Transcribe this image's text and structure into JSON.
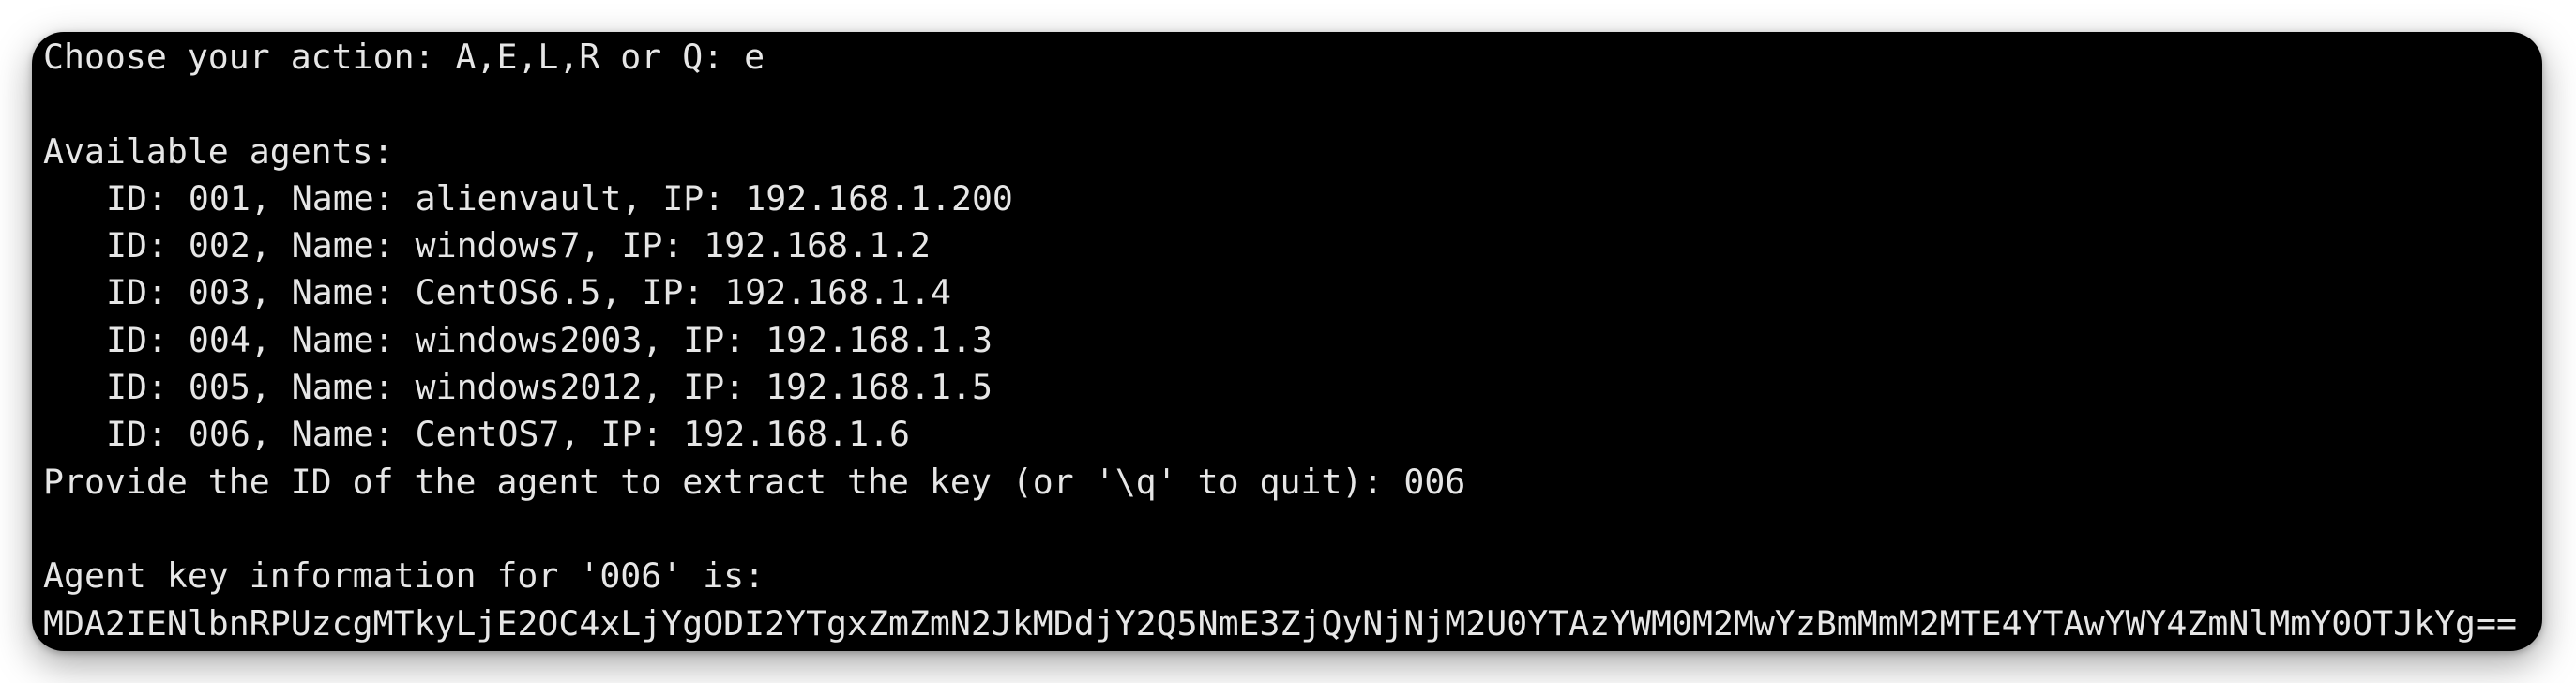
{
  "terminal": {
    "prompt_label": "Choose your action: A,E,L,R or Q: ",
    "prompt_input": "e",
    "blank_1": "",
    "agents_header": "Available agents:",
    "agents": [
      "ID: 001, Name: alienvault, IP: 192.168.1.200",
      "ID: 002, Name: windows7, IP: 192.168.1.2",
      "ID: 003, Name: CentOS6.5, IP: 192.168.1.4",
      "ID: 004, Name: windows2003, IP: 192.168.1.3",
      "ID: 005, Name: windows2012, IP: 192.168.1.5",
      "ID: 006, Name: CentOS7, IP: 192.168.1.6"
    ],
    "id_prompt_label": "Provide the ID of the agent to extract the key (or '\\q' to quit): ",
    "id_prompt_input": "006",
    "blank_2": "",
    "key_info_header": "Agent key information for '006' is:",
    "key_value": "MDA2IENlbnRPUzcgMTkyLjE2OC4xLjYgODI2YTgxZmZmN2JkMDdjY2Q5NmE3ZjQyNjNjM2U0YTAzYWM0M2MwYzBmMmM2MTE4YTAwYWY4ZmNlMmY0OTJkYg=="
  },
  "colors": {
    "background": "#000000",
    "text": "#e6e6e6",
    "page": "#ffffff"
  }
}
